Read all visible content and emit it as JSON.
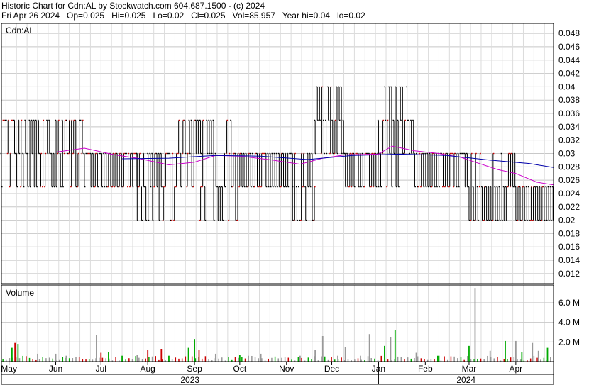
{
  "header": {
    "line1": "Historic Chart for Cdn:AL by Stockwatch.com 604.687.1500 - (c) 2024",
    "line2": "Fri Apr 26 2024   Op=0.025   Hi=0.025   Lo=0.02   Cl=0.025   Vol=85,957   Year hi=0.04   lo=0.02"
  },
  "colors": {
    "up": "#cc0000",
    "down": "#000000",
    "ma_short": "#cc00cc",
    "ma_long": "#0000aa",
    "vol_up": "#00aa00",
    "vol_down": "#cc0000",
    "vol_flat": "#999999",
    "grid": "#c8c8c8"
  },
  "chart_data": [
    {
      "type": "line",
      "title": "Cdn:AL",
      "y_ticks": [
        "0.012",
        "0.014",
        "0.016",
        "0.018",
        "0.02",
        "0.022",
        "0.024",
        "0.026",
        "0.028",
        "0.03",
        "0.032",
        "0.034",
        "0.036",
        "0.038",
        "0.04",
        "0.042",
        "0.044",
        "0.046",
        "0.048"
      ],
      "ylim": [
        0.0105,
        0.0495
      ],
      "x_month_labels": [
        "May",
        "Jun",
        "Jul",
        "Aug",
        "Sep",
        "Oct",
        "Nov",
        "Dec",
        "Jan",
        "Feb",
        "Mar",
        "Apr"
      ],
      "x_year_labels": [
        "2023",
        "2024"
      ],
      "xlim": [
        "2023-04-26",
        "2024-04-26"
      ],
      "month_starts": [
        "2023-05-01",
        "2023-06-01",
        "2023-07-01",
        "2023-08-01",
        "2023-09-01",
        "2023-10-01",
        "2023-11-01",
        "2023-12-01",
        "2024-01-01",
        "2024-02-01",
        "2024-03-01",
        "2024-04-01"
      ],
      "year_start": "2024-01-01",
      "price_segments": [
        {
          "start": "2023-04-26",
          "end": "2023-06-20",
          "levels": [
            0.025,
            0.03,
            0.035
          ]
        },
        {
          "start": "2023-06-20",
          "end": "2023-07-25",
          "levels": [
            0.025,
            0.03
          ]
        },
        {
          "start": "2023-07-25",
          "end": "2023-08-20",
          "levels": [
            0.02,
            0.025,
            0.03
          ]
        },
        {
          "start": "2023-08-20",
          "end": "2023-09-05",
          "levels": [
            0.025,
            0.03,
            0.035
          ]
        },
        {
          "start": "2023-09-05",
          "end": "2023-10-01",
          "levels": [
            0.02,
            0.025,
            0.03,
            0.035
          ]
        },
        {
          "start": "2023-10-01",
          "end": "2023-11-05",
          "levels": [
            0.025,
            0.03
          ]
        },
        {
          "start": "2023-11-05",
          "end": "2023-11-20",
          "levels": [
            0.02,
            0.025,
            0.03
          ]
        },
        {
          "start": "2023-11-20",
          "end": "2023-12-10",
          "levels": [
            0.03,
            0.035,
            0.04
          ]
        },
        {
          "start": "2023-12-10",
          "end": "2024-01-01",
          "levels": [
            0.025,
            0.03
          ]
        },
        {
          "start": "2024-01-01",
          "end": "2024-01-25",
          "levels": [
            0.025,
            0.03,
            0.035,
            0.04
          ]
        },
        {
          "start": "2024-01-25",
          "end": "2024-03-01",
          "levels": [
            0.025,
            0.03
          ]
        },
        {
          "start": "2024-03-01",
          "end": "2024-04-01",
          "levels": [
            0.02,
            0.025,
            0.03
          ]
        },
        {
          "start": "2024-04-01",
          "end": "2024-04-26",
          "levels": [
            0.02,
            0.025
          ]
        }
      ],
      "series": [
        {
          "values": [
            {
              "date": "2023-06-01",
              "value": 0.0302
            },
            {
              "date": "2023-06-20",
              "value": 0.0308
            },
            {
              "date": "2023-07-10",
              "value": 0.0298
            },
            {
              "date": "2023-07-25",
              "value": 0.0293
            },
            {
              "date": "2023-08-15",
              "value": 0.0283
            },
            {
              "date": "2023-09-01",
              "value": 0.0287
            },
            {
              "date": "2023-09-15",
              "value": 0.0297
            },
            {
              "date": "2023-10-01",
              "value": 0.0296
            },
            {
              "date": "2023-10-20",
              "value": 0.0291
            },
            {
              "date": "2023-11-10",
              "value": 0.0284
            },
            {
              "date": "2023-11-25",
              "value": 0.0293
            },
            {
              "date": "2023-12-10",
              "value": 0.0298
            },
            {
              "date": "2024-01-01",
              "value": 0.0299
            },
            {
              "date": "2024-01-10",
              "value": 0.0311
            },
            {
              "date": "2024-01-25",
              "value": 0.0304
            },
            {
              "date": "2024-02-10",
              "value": 0.03
            },
            {
              "date": "2024-02-25",
              "value": 0.0294
            },
            {
              "date": "2024-03-05",
              "value": 0.0287
            },
            {
              "date": "2024-03-20",
              "value": 0.0276
            },
            {
              "date": "2024-04-01",
              "value": 0.027
            },
            {
              "date": "2024-04-15",
              "value": 0.0257
            },
            {
              "date": "2024-04-26",
              "value": 0.0253
            }
          ]
        },
        {
          "values": [
            {
              "date": "2023-07-15",
              "value": 0.0292
            },
            {
              "date": "2023-08-15",
              "value": 0.0293
            },
            {
              "date": "2023-09-15",
              "value": 0.0297
            },
            {
              "date": "2023-10-15",
              "value": 0.0296
            },
            {
              "date": "2023-11-15",
              "value": 0.0291
            },
            {
              "date": "2023-12-15",
              "value": 0.0297
            },
            {
              "date": "2024-01-15",
              "value": 0.0299
            },
            {
              "date": "2024-02-15",
              "value": 0.0297
            },
            {
              "date": "2024-03-15",
              "value": 0.029
            },
            {
              "date": "2024-04-10",
              "value": 0.0285
            },
            {
              "date": "2024-04-26",
              "value": 0.0279
            }
          ]
        }
      ]
    },
    {
      "type": "bar",
      "title": "Volume",
      "y_ticks": [
        "2.0 M",
        "4.0 M",
        "6.0 M"
      ],
      "ylim": [
        0,
        7.8
      ],
      "units": "M shares",
      "x": [
        "2023-05-03",
        "2023-05-05",
        "2023-05-07",
        "2023-05-20",
        "2023-06-01",
        "2023-06-08",
        "2023-06-28",
        "2023-07-01",
        "2023-07-06",
        "2023-07-15",
        "2023-07-25",
        "2023-08-01",
        "2023-08-10",
        "2023-08-15",
        "2023-08-28",
        "2023-09-01",
        "2023-09-04",
        "2023-09-15",
        "2023-10-01",
        "2023-10-15",
        "2023-11-10",
        "2023-11-20",
        "2023-11-25",
        "2023-12-05",
        "2023-12-10",
        "2023-12-20",
        "2023-12-26",
        "2024-01-05",
        "2024-01-09",
        "2024-01-12",
        "2024-01-26",
        "2024-02-10",
        "2024-03-01",
        "2024-03-05",
        "2024-03-15",
        "2024-03-25",
        "2024-04-01",
        "2024-04-05",
        "2024-04-12",
        "2024-04-16",
        "2024-04-22"
      ],
      "values": [
        1.4,
        1.9,
        1.8,
        0.8,
        0.8,
        0.6,
        2.7,
        0.9,
        1.0,
        0.6,
        0.7,
        1.2,
        1.3,
        0.6,
        1.4,
        2.3,
        1.2,
        0.8,
        0.7,
        0.8,
        0.6,
        1.2,
        2.6,
        0.6,
        1.5,
        0.6,
        2.8,
        1.6,
        2.5,
        3.2,
        0.9,
        0.6,
        1.6,
        7.5,
        1.1,
        2.1,
        2.1,
        1.0,
        1.9,
        1.1,
        1.4
      ],
      "directions": [
        "up",
        "down",
        "up",
        "flat",
        "flat",
        "flat",
        "flat",
        "down",
        "up",
        "up",
        "flat",
        "down",
        "down",
        "up",
        "up",
        "up",
        "down",
        "flat",
        "up",
        "flat",
        "flat",
        "flat",
        "flat",
        "flat",
        "flat",
        "flat",
        "flat",
        "up",
        "flat",
        "up",
        "flat",
        "up",
        "up",
        "flat",
        "flat",
        "up",
        "flat",
        "up",
        "flat",
        "flat",
        "up"
      ]
    }
  ]
}
